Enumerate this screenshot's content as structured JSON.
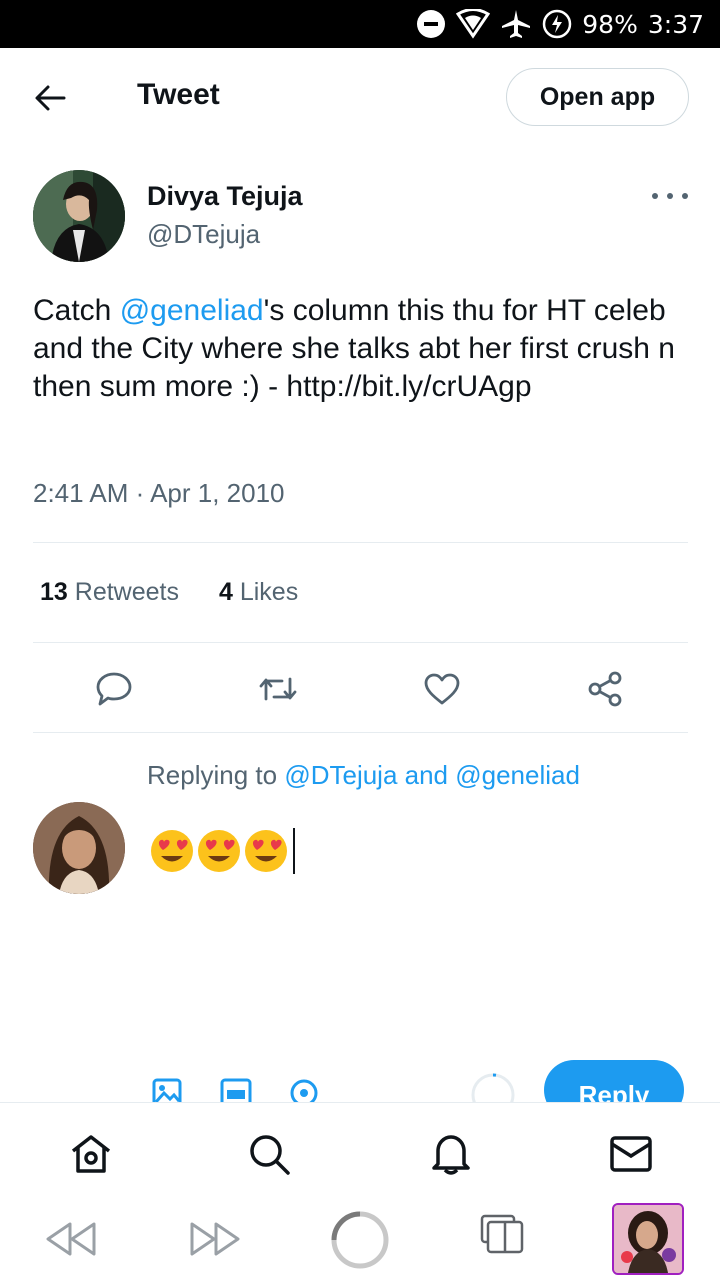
{
  "status_bar": {
    "battery": "98%",
    "time": "3:37"
  },
  "header": {
    "title": "Tweet",
    "open_app_label": "Open app"
  },
  "tweet": {
    "author_name": "Divya Tejuja",
    "author_handle": "@DTejuja",
    "text_prefix": "Catch ",
    "text_mention": "@geneliad",
    "text_suffix": "'s column this thu for HT celeb and the City where she talks abt her first crush n then sum more :) - http://bit.ly/crUAgp",
    "timestamp": "2:41 AM · Apr 1, 2010",
    "retweets_count": "13",
    "retweets_label": "Retweets",
    "likes_count": "4",
    "likes_label": "Likes"
  },
  "reply": {
    "replying_prefix": "Replying to ",
    "replying_mentions": "@DTejuja and @geneliad",
    "draft_text": "😍😍😍",
    "reply_button": "Reply"
  },
  "icons": {
    "back": "arrow-left-icon",
    "more": "more-horizontal-icon",
    "comment": "comment-icon",
    "retweet": "retweet-icon",
    "like": "heart-icon",
    "share": "share-icon",
    "image": "image-icon",
    "gif": "gif-icon",
    "location": "location-icon",
    "home": "home-icon",
    "search": "search-icon",
    "notifications": "bell-icon",
    "messages": "mail-icon"
  },
  "colors": {
    "accent": "#1d9bf0",
    "text": "#0f1419",
    "secondary": "#536471"
  }
}
